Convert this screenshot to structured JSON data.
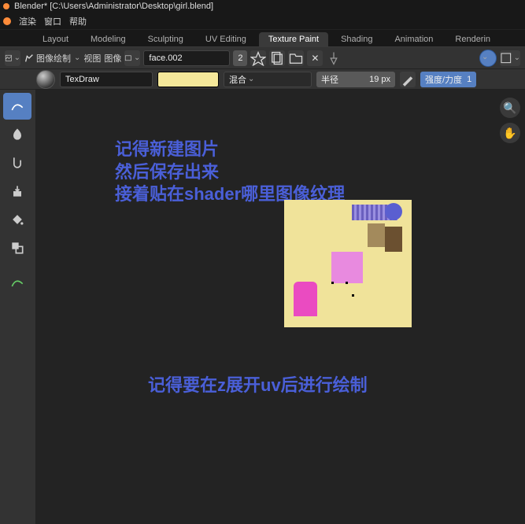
{
  "titlebar": "Blender* [C:\\Users\\Administrator\\Desktop\\girl.blend]",
  "menu": {
    "render": "渲染",
    "window": "窗口",
    "help": "帮助"
  },
  "tabs": {
    "layout": "Layout",
    "modeling": "Modeling",
    "sculpting": "Sculpting",
    "uvediting": "UV Editing",
    "texturepaint": "Texture Paint",
    "shading": "Shading",
    "animation": "Animation",
    "rendering": "Renderin"
  },
  "iconbar": {
    "mode": "图像绘制",
    "view": "视图",
    "image": "图像",
    "imgname": "face.002",
    "imgusers": "2"
  },
  "brush": {
    "name": "TexDraw",
    "blend": "混合",
    "radius_label": "半径",
    "radius_value": "19 px",
    "strength_label": "强度/力度",
    "strength_value": "1"
  },
  "annotations": {
    "line1": "记得新建图片",
    "line2": "然后保存出来",
    "line3": "接着贴在shader哪里图像纹理",
    "bottom": "记得要在z展开uv后进行绘制"
  }
}
